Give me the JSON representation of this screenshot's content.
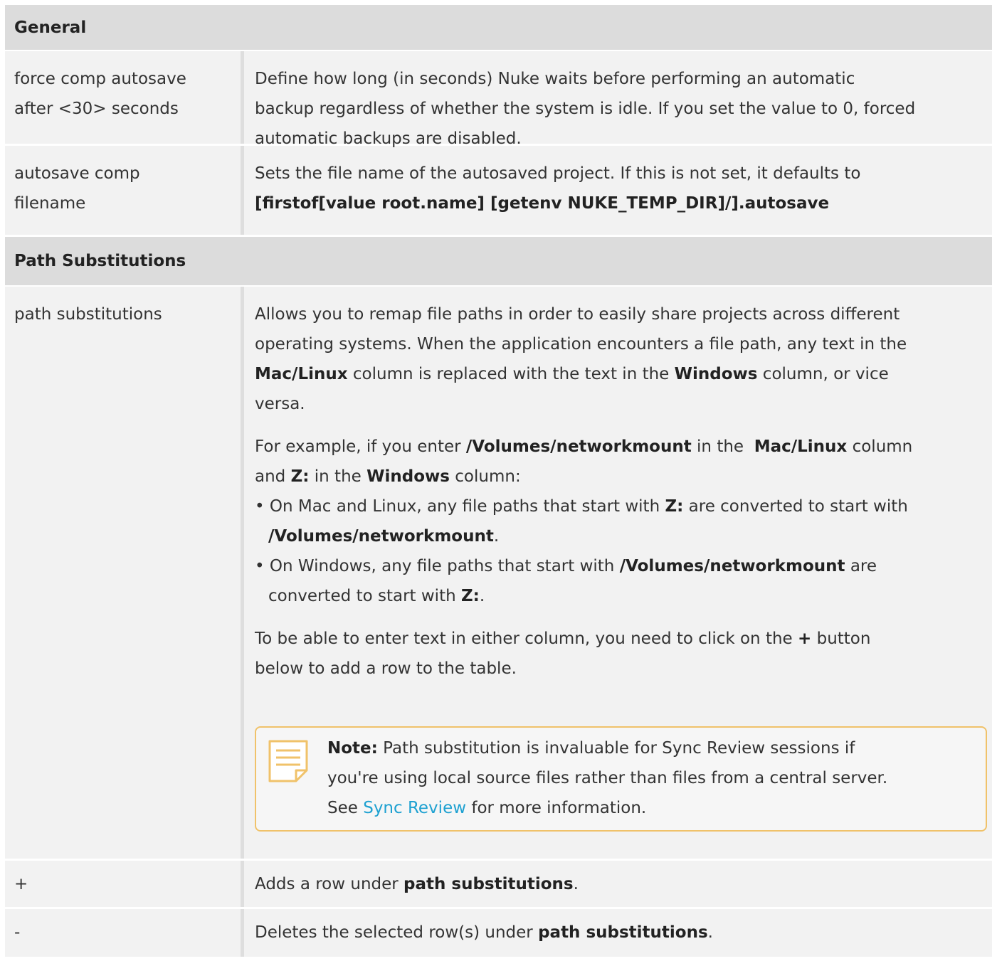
{
  "sections": {
    "general": "General",
    "path_substitutions": "Path Substitutions"
  },
  "rows": {
    "force_autosave": {
      "name_1": "force comp autosave",
      "name_2": "after <30> seconds",
      "desc_1": "Define how long (in seconds) Nuke waits before performing an automatic",
      "desc_2": "backup regardless of whether the system is idle. If you set the value to 0, forced",
      "desc_3": "automatic backups are disabled."
    },
    "autosave_filename": {
      "name_1": "autosave comp",
      "name_2": "filename",
      "desc_1": "Sets the file name of the autosaved project. If this is not set, it defaults to",
      "desc_2": "[firstof[value root.name] [getenv NUKE_TEMP_DIR]/].autosave"
    },
    "path_subs": {
      "name": "path substitutions",
      "p1_l1": "Allows you to remap file paths in order to easily share projects across different",
      "p1_l2": "operating systems. When the application encounters a file path, any text in the",
      "p1_l3_b1": "Mac/Linux",
      "p1_l3_t1": " column is replaced with the text in the ",
      "p1_l3_b2": "Windows",
      "p1_l3_t2": " column, or vice",
      "p1_l4": "versa.",
      "p2_l1_t1": "For example, if you enter ",
      "p2_l1_b1": "/Volumes/networkmount",
      "p2_l1_t2": " in the  ",
      "p2_l1_b2": "Mac/Linux",
      "p2_l1_t3": " column",
      "p2_l2_t1": "and ",
      "p2_l2_b1": "Z:",
      "p2_l2_t2": " in the ",
      "p2_l2_b2": "Windows",
      "p2_l2_t3": " column:",
      "b1_t1": "• On Mac and Linux, any file paths that start with ",
      "b1_b1": "Z:",
      "b1_t2": " are converted to start with",
      "b1_b2": "/Volumes/networkmount",
      "b1_t3": ".",
      "b2_t1": "• On Windows, any file paths that start with ",
      "b2_b1": "/Volumes/networkmount",
      "b2_t2": " are",
      "b2_t3": "converted to start with ",
      "b2_b2": "Z:",
      "b2_t4": ".",
      "p3_l1_t1": "To be able to enter text in either column, you need to click on the ",
      "p3_l1_b1": "+",
      "p3_l1_t2": " button",
      "p3_l2": "below to add a row to the table.",
      "note_label": "Note:",
      "note_l1": " Path substitution is invaluable for Sync Review sessions if",
      "note_l2": "you're using local source files rather than files from a central server.",
      "note_l3_t1": "See ",
      "note_link": "Sync Review",
      "note_l3_t2": " for more information."
    },
    "add": {
      "name": "+",
      "desc_t1": "Adds a row under ",
      "desc_b1": "path substitutions",
      "desc_t2": "."
    },
    "delete": {
      "name": "-",
      "desc_t1": "Deletes the selected row(s) under ",
      "desc_b1": "path substitutions",
      "desc_t2": "."
    }
  },
  "icons": {
    "note": "note-icon"
  },
  "colors": {
    "section_bg": "#dcdcdc",
    "row_bg": "#f2f2f2",
    "note_border": "#f0c26a",
    "link": "#1ea1d1"
  }
}
